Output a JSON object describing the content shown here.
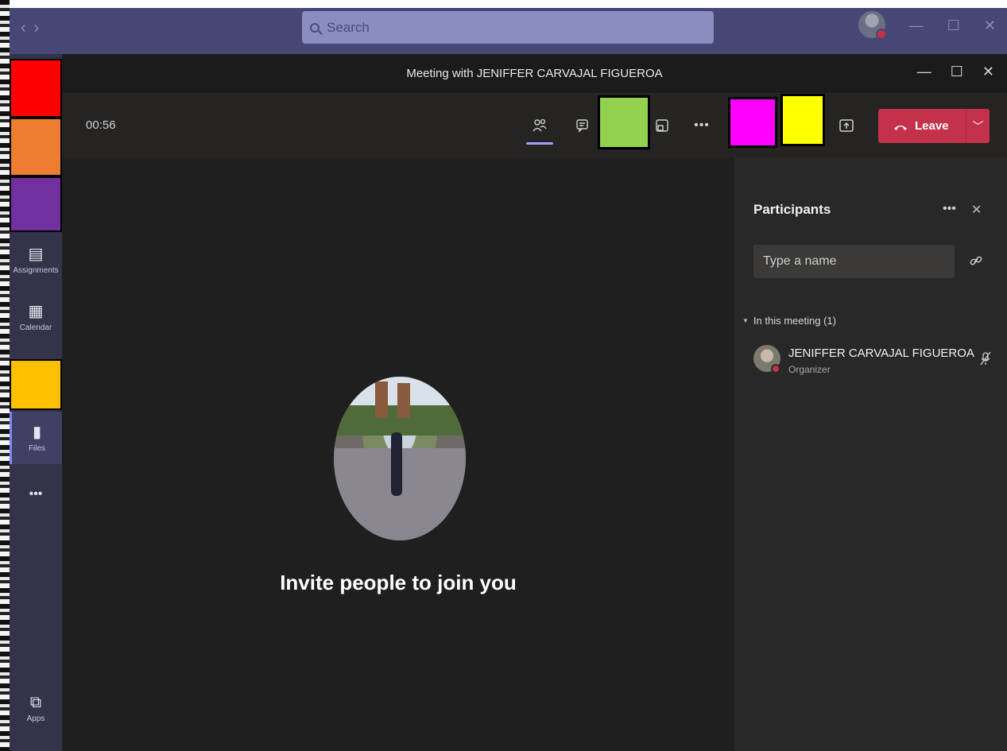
{
  "app": {
    "search": {
      "placeholder": "Search",
      "icon": "search-icon"
    },
    "nav": {
      "back": "‹",
      "forward": "›"
    },
    "window_controls": {
      "minimize": "—",
      "maximize": "☐",
      "close": "✕"
    }
  },
  "sidebar": {
    "blocks": [
      {
        "color": "#ff0000"
      },
      {
        "color": "#ed7d31"
      },
      {
        "color": "#7030a0"
      },
      {
        "color": "#ffc000"
      }
    ],
    "items": [
      {
        "label": "Assignments",
        "icon": "assignments-icon",
        "glyph": "🗂"
      },
      {
        "label": "Calendar",
        "icon": "calendar-icon",
        "glyph": "▦"
      },
      {
        "label": "Files",
        "icon": "files-icon",
        "glyph": "▮"
      },
      {
        "label": "•••",
        "icon": "more-apps-icon"
      },
      {
        "label": "Apps",
        "icon": "apps-icon",
        "glyph": "⧉"
      }
    ]
  },
  "meeting": {
    "title": "Meeting with JENIFFER CARVAJAL FIGUEROA",
    "timer": "00:56",
    "leave_label": "Leave",
    "toolbar_colors": {
      "green": "#92d050",
      "magenta": "#ff00ff",
      "yellow": "#ffff00"
    },
    "stage_text": "Invite people to join you"
  },
  "participants": {
    "title": "Participants",
    "input_placeholder": "Type a name",
    "section_label": "In this meeting (1)",
    "people": [
      {
        "name": "JENIFFER CARVAJAL FIGUEROA",
        "role": "Organizer"
      }
    ]
  },
  "colors": {
    "leave": "#c4314b",
    "titlebar": "#464775",
    "sidebar": "#33344a",
    "stage": "#1f1f1f"
  }
}
